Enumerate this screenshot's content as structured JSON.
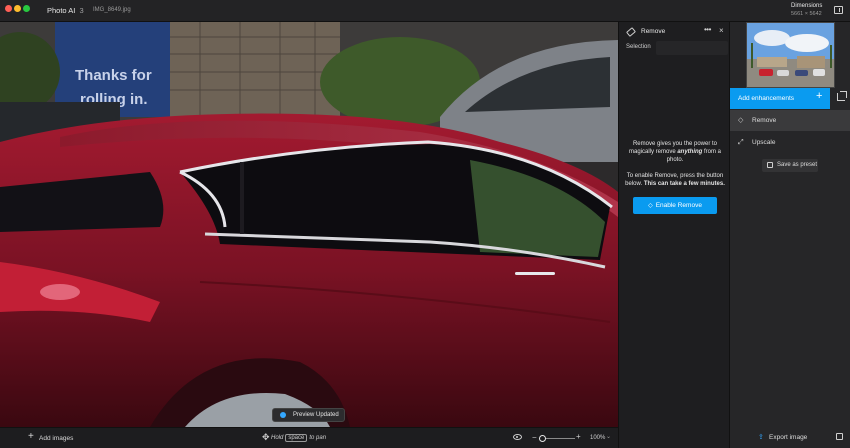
{
  "app": {
    "name": "Photo AI",
    "version": "3",
    "file_name": "IMG_8649.jpg"
  },
  "dimensions": {
    "label": "Dimensions",
    "value": "5661 × 5642"
  },
  "photo": {
    "sign_line1": "Thanks for",
    "sign_line2": "rolling in."
  },
  "toast": {
    "text": "Preview Updated"
  },
  "bottom_bar": {
    "add_images": "Add images",
    "pan_hint_prefix": "Hold",
    "pan_hint_key": "space",
    "pan_hint_suffix": "to pan",
    "zoom_level": "100%",
    "zoom_fraction": 0.0
  },
  "tool_panel": {
    "title": "Remove",
    "more_label": "•••",
    "close_label": "×",
    "selection_label": "Selection",
    "desc_part1": "Remove gives you the power to magically remove ",
    "desc_emphasis": "anything",
    "desc_part2": " from a photo.",
    "enable_hint": "To enable Remove, press the button below. ",
    "enable_hint_bold": "This can take a few minutes.",
    "enable_button": "Enable Remove"
  },
  "sidebar": {
    "add_enhancements": "Add enhancements",
    "items": [
      {
        "label": "Remove",
        "icon": "eraser-icon",
        "active": true
      },
      {
        "label": "Upscale",
        "icon": "expand-icon",
        "active": false
      }
    ],
    "save_preset": "Save as preset",
    "export": "Export image"
  },
  "colors": {
    "accent": "#0a9bf0",
    "car_red": "#8a1426",
    "background": "#1c1c1e"
  }
}
